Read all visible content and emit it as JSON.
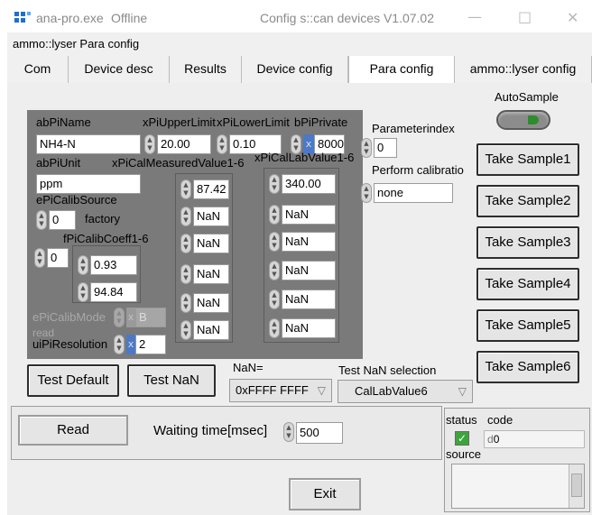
{
  "window": {
    "app_name": "ana-pro.exe",
    "status": "Offline",
    "title": "Config s::can devices V1.07.02",
    "minimize": "—",
    "maximize": "□",
    "close": "✕"
  },
  "menubar": {
    "label": "ammo::lyser Para config"
  },
  "tabs": [
    {
      "label": "Com"
    },
    {
      "label": "Device desc"
    },
    {
      "label": "Results"
    },
    {
      "label": "Device config"
    },
    {
      "label": "Para config"
    },
    {
      "label": "ammo::lyser config"
    }
  ],
  "params": {
    "abPiName_label": "abPiName",
    "abPiName_value": "NH4-N",
    "xPiUpperLimit_label": "xPiUpperLimit",
    "xPiUpperLimit_value": "20.00",
    "xPiLowerLimit_label": "xPiLowerLimit",
    "xPiLowerLimit_value": "0.10",
    "bPiPrivate_label": "bPiPrivate",
    "bPiPrivate_prefix": "x",
    "bPiPrivate_value": "8000",
    "abPiUnit_label": "abPiUnit",
    "abPiUnit_value": "ppm",
    "xPiCalMeasured_label": "xPiCalMeasuredValue1-6",
    "xPiCalLab_label": "xPiCalLabValue1-6",
    "ePiCalibSource_label": "ePiCalibSource",
    "ePiCalibSource_value": "0",
    "ePiCalibSource_text": "factory",
    "fPiCalibCoeff_label": "fPiCalibCoeff1-6",
    "fPiCalibCoeff_index": "0",
    "fPiCalibCoeff_values": [
      "0.93",
      "94.84"
    ],
    "measured_values": [
      "87.42",
      "NaN",
      "NaN",
      "NaN",
      "NaN",
      "NaN"
    ],
    "lab_values": [
      "340.00",
      "NaN",
      "NaN",
      "NaN",
      "NaN",
      "NaN"
    ],
    "ePiCalibMode_label": "ePiCalibMode",
    "ePiCalibMode_prefix": "x",
    "ePiCalibMode_value": "B",
    "read_label": "read",
    "uiPiResolution_label": "uiPiResolution",
    "uiPiResolution_prefix": "x",
    "uiPiResolution_value": "2"
  },
  "right": {
    "parameterindex_label": "Parameterindex",
    "parameterindex_value": "0",
    "perform_calibration_label": "Perform calibratio",
    "perform_calibration_value": "none",
    "autosample_label": "AutoSample",
    "take_samples": [
      "Take Sample1",
      "Take Sample2",
      "Take Sample3",
      "Take Sample4",
      "Take Sample5",
      "Take Sample6"
    ]
  },
  "test": {
    "default_label": "Test Default",
    "nan_label": "Test NaN",
    "nan_eq_label": "NaN=",
    "nan_value": "0xFFFF FFFF",
    "selection_label": "Test NaN selection",
    "selection_value": "CalLabValue6"
  },
  "bottom": {
    "read_label": "Read",
    "waiting_label": "Waiting time[msec]",
    "waiting_value": "500",
    "exit_label": "Exit",
    "status_label": "status",
    "code_label": "code",
    "code_prefix": "d",
    "code_value": "0",
    "source_label": "source"
  },
  "colors": {
    "dark_panel": "#7a7a7a",
    "status_check": "#3aa63a",
    "led_green": "#2e8b2e"
  }
}
